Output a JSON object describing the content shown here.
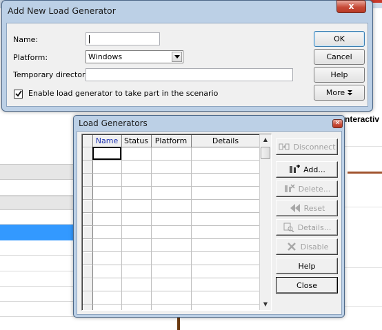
{
  "add_dialog": {
    "title": "Add New Load Generator",
    "name_label": "Name:",
    "name_value": "",
    "platform_label": "Platform:",
    "platform_value": "Windows",
    "tempdir_label": "Temporary directory:",
    "tempdir_value": "",
    "enable_checked": true,
    "enable_label": "Enable load generator to take part in the scenario",
    "close_glyph": "x",
    "buttons": {
      "ok": "OK",
      "cancel": "Cancel",
      "help": "Help",
      "more": "More"
    }
  },
  "lg_dialog": {
    "title": "Load Generators",
    "columns": [
      "Name",
      "Status",
      "Platform",
      "Details"
    ],
    "row_count": 13,
    "buttons": {
      "disconnect": "Disconnect",
      "add": "Add...",
      "delete": "Delete...",
      "reset": "Reset",
      "details": "Details...",
      "disable": "Disable",
      "help": "Help",
      "close": "Close"
    }
  },
  "background": {
    "partial_label": "nteractiv"
  },
  "colors": {
    "window_frame": "#bcd0e6",
    "selected_row": "#3399ff",
    "close_button": "#c74b38"
  }
}
